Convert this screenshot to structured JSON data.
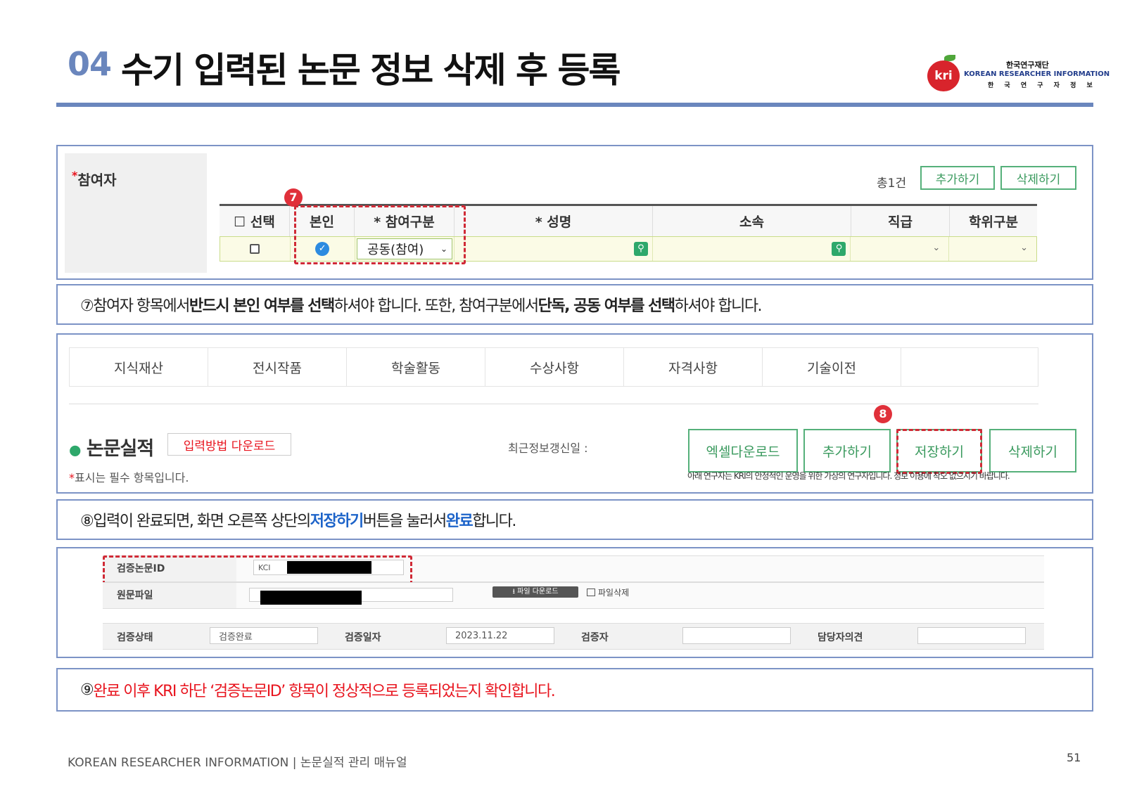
{
  "header": {
    "section_number": "04",
    "title": "수기 입력된 논문 정보 삭제 후 등록"
  },
  "logo": {
    "mark": "kri",
    "line1": "한국연구재단",
    "line2": "KOREAN RESEARCHER INFORMATION",
    "line3": "한 국 연 구 자 정 보"
  },
  "participants": {
    "label": "참여자",
    "required_mark": "*",
    "total": "총1건",
    "add_button": "추가하기",
    "delete_button": "삭제하기",
    "badge": "7",
    "columns": [
      "☐ 선택",
      "본인",
      "* 참여구분",
      "* 성명",
      "소속",
      "직급",
      "학위구분"
    ],
    "row": {
      "participation_type": "공동(참여)"
    }
  },
  "note7": {
    "p1": "⑦참여자 항목에서 ",
    "b1": "반드시 본인 여부를 선택",
    "p2": "하셔야 합니다. 또한, 참여구분에서 ",
    "b2": "단독, 공동 여부를 선택",
    "p3": "하셔야 합니다."
  },
  "achievements": {
    "tabs": [
      "지식재산",
      "전시작품",
      "학술활동",
      "수상사항",
      "자격사항",
      "기술이전",
      ""
    ],
    "section_title": "논문실적",
    "input_method_download": "입력방법 다운로드",
    "required_note_mark": "*",
    "required_note": "표시는 필수 항목입니다.",
    "last_update_label": "최근정보갱신일 :",
    "buttons": {
      "excel": "엑셀다운로드",
      "add": "추가하기",
      "save": "저장하기",
      "delete": "삭제하기"
    },
    "badge": "8",
    "footnote": "아래 연구자는 KRI의 안정적인 운영을 위한 가상의 연구자입니다. 정보 이용에 착오 없으시기 바랍니다."
  },
  "note8": {
    "p1": "⑧입력이 완료되면, 화면 오른쪽 상단의 ",
    "b1": "저장하기",
    "p2": " 버튼을 눌러서 ",
    "b2": "완료",
    "p3": "합니다."
  },
  "verification": {
    "paper_id_label": "검증논문ID",
    "paper_id_prefix": "KCI",
    "original_file_label": "원문파일",
    "file_download_button": "파일 다운로드",
    "file_delete_label": "파일삭제",
    "status_label": "검증상태",
    "status_value": "검증완료",
    "date_label": "검증일자",
    "date_value": "2023.11.22",
    "verifier_label": "검증자",
    "manager_opinion_label": "담당자의견"
  },
  "note9": {
    "num": "⑨ ",
    "text": "완료 이후 KRI 하단 ‘검증논문ID’ 항목이 정상적으로 등록되었는지 확인합니다."
  },
  "footer": {
    "left": "KOREAN RESEARCHER INFORMATION  |  논문실적 관리 매뉴얼",
    "page": "51"
  },
  "colors": {
    "accent": "#6a86bd",
    "red": "#e8141e",
    "green": "#3a9a5e",
    "blue_emphasis": "#1c63c9"
  }
}
